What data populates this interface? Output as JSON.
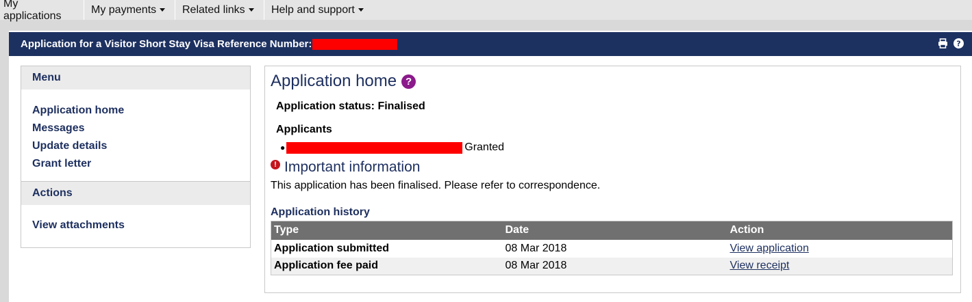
{
  "topnav": {
    "items": [
      {
        "label": "My applications"
      },
      {
        "label": "My payments"
      },
      {
        "label": "Related links"
      },
      {
        "label": "Help and support"
      }
    ]
  },
  "header": {
    "title": "Application for a Visitor Short Stay Visa Reference Number:",
    "icons": [
      "print-icon",
      "help-icon"
    ],
    "background": "#1d3161"
  },
  "sidebar": {
    "menu_title": "Menu",
    "menu_items": [
      {
        "label": "Application home"
      },
      {
        "label": "Messages"
      },
      {
        "label": "Update details"
      },
      {
        "label": "Grant letter"
      }
    ],
    "actions_title": "Actions",
    "action_items": [
      {
        "label": "View attachments"
      }
    ]
  },
  "main": {
    "title": "Application home",
    "status_label": "Application status: Finalised",
    "applicants_title": "Applicants",
    "applicants": [
      {
        "status": "Granted"
      }
    ],
    "important_title": "Important information",
    "important_text": "This application has been finalised. Please refer to correspondence.",
    "history_title": "Application history",
    "history_columns": [
      "Type",
      "Date",
      "Action"
    ],
    "history_rows": [
      {
        "type": "Application submitted",
        "date": "08 Mar 2018",
        "action": "View application"
      },
      {
        "type": "Application fee paid",
        "date": "08 Mar 2018",
        "action": "View receipt"
      }
    ]
  },
  "colors": {
    "brand_navy": "#1d3161",
    "link": "#1d2f5f",
    "help_purple": "#8b1a8b",
    "warning_red": "#c4161c",
    "redaction": "#ff0000"
  }
}
